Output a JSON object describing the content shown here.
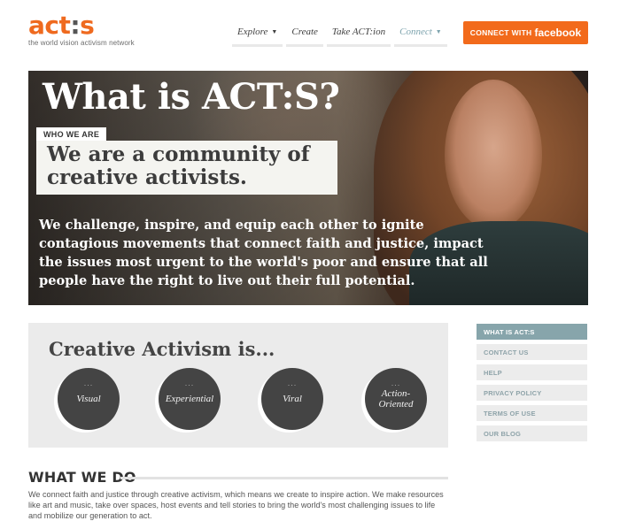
{
  "logo": {
    "mark_start": "act",
    "mark_colon": ":",
    "mark_end": "s",
    "tagline": "the world vision activism network"
  },
  "nav": {
    "items": [
      {
        "label": "Explore",
        "has_caret": true
      },
      {
        "label": "Create",
        "has_caret": false
      },
      {
        "label": "Take ACT:ion",
        "has_caret": false
      },
      {
        "label": "Connect",
        "has_caret": true
      }
    ],
    "caret": "▼"
  },
  "facebook_button": {
    "prefix": "Connect with",
    "brand": "facebook"
  },
  "hero": {
    "title": "What is ACT:S?",
    "tag": "WHO WE ARE",
    "headline": "We are a community of creative activists.",
    "body": "We challenge, inspire, and equip each other to ignite contagious movements that connect faith and justice, impact the issues most urgent to the world's poor and ensure that all people have the right to live out their full potential."
  },
  "creative": {
    "title": "Creative Activism is...",
    "dots": "...",
    "circles": [
      "Visual",
      "Experiential",
      "Viral",
      "Action-Oriented"
    ]
  },
  "what_we_do": {
    "title": "WHAT WE DO",
    "body": "We connect faith and justice through creative activism, which means we create to inspire action. We make resources like art and music, take over spaces, host events and tell stories to bring the world's most challenging issues to life and mobilize our generation to act."
  },
  "side_menu": {
    "items": [
      "What is ACT:S",
      "Contact Us",
      "Help",
      "Privacy Policy",
      "Terms of Use",
      "Our Blog"
    ],
    "active_index": 0
  },
  "colors": {
    "brand_orange": "#f26a1b",
    "accent_teal": "#87a5ab",
    "dark_circle": "#444444"
  }
}
